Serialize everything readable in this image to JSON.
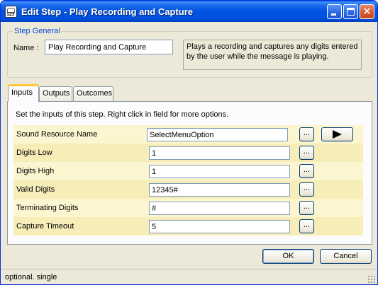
{
  "window": {
    "title": "Edit Step - Play Recording and Capture",
    "icon": "phone-123-icon"
  },
  "step_general": {
    "legend": "Step General",
    "name_label": "Name :",
    "name_value": "Play Recording and Capture",
    "description": "Plays a recording and captures any digits entered by the user while the message is playing."
  },
  "tabs": [
    {
      "label": "Inputs",
      "active": true
    },
    {
      "label": "Outputs",
      "active": false
    },
    {
      "label": "Outcomes",
      "active": false
    }
  ],
  "inputs": {
    "instructions": "Set the inputs of this step.  Right click in field for more options.",
    "ellipsis_label": "...",
    "rows": [
      {
        "label": "Sound Resource Name",
        "value": "SelectMenuOption"
      },
      {
        "label": "Digits Low",
        "value": "1"
      },
      {
        "label": "Digits High",
        "value": "1"
      },
      {
        "label": "Valid Digits",
        "value": "12345#"
      },
      {
        "label": "Terminating Digits",
        "value": "#"
      },
      {
        "label": "Capture Timeout",
        "value": "5"
      }
    ]
  },
  "buttons": {
    "ok": "OK",
    "cancel": "Cancel"
  },
  "status": {
    "text": "optional. single"
  },
  "colors": {
    "title_bar": "#0054e3",
    "row_light": "#fbf6cf",
    "row_dark": "#f7edb8",
    "active_tab_accent": "#ffc73c",
    "group_legend": "#0046d5"
  }
}
